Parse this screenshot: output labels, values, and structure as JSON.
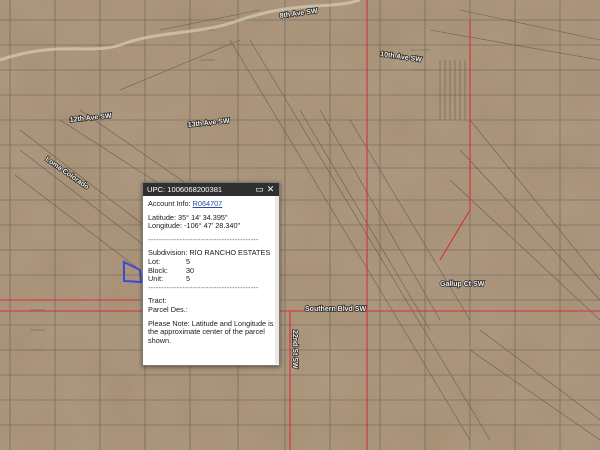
{
  "map": {
    "roads": [
      {
        "name": "8th Ave SW"
      },
      {
        "name": "10th Ave SW"
      },
      {
        "name": "12th Ave SW"
      },
      {
        "name": "13th Ave SW"
      },
      {
        "name": "Southern Blvd SW"
      },
      {
        "name": "Gallup Ct SW"
      },
      {
        "name": "22nd St SW"
      },
      {
        "name": "Loma Colorado"
      }
    ],
    "parcel_outline_color": "#3b4bd8",
    "boundary_color": "#d6303a"
  },
  "popup": {
    "title": "UPC: 1006068200381",
    "minimize_icon": "minimize-icon",
    "close_icon": "close-icon",
    "account_label": "Account Info:",
    "account_value": "R064707",
    "latitude": "Latitude: 35° 14' 34.395\"",
    "longitude": "Longitude: -106° 47' 28.340\"",
    "separator": "------------------------------------------",
    "subdivision_label": "Subdivision:",
    "subdivision_value": "RIO RANCHO ESTATES",
    "lot_label": "Lot:",
    "lot_value": "5",
    "block_label": "Block:",
    "block_value": "30",
    "unit_label": "Unit:",
    "unit_value": "5",
    "tract_label": "Tract:",
    "parcel_desc_label": "Parcel Des.:",
    "note": "Please Note: Latitude and Longitude is the approximate center of the parcel shown."
  }
}
